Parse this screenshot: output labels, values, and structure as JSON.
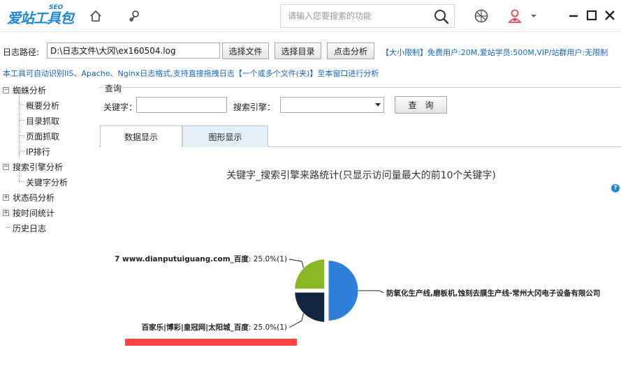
{
  "titlebar": {
    "logo_main": "爱站工具包",
    "logo_seo": "SEO",
    "search_placeholder": "请输入您要搜索的功能"
  },
  "toolbar": {
    "path_label": "日志路径:",
    "path_value": "D:\\日志文件\\大冈\\ex160504.log",
    "btn_select_file": "选择文件",
    "btn_select_dir": "选择目录",
    "btn_analyze": "点击分析",
    "limit_text": "【大小限制】免费用户:20M,爱站学员:500M,VIP/站群用户:无限制"
  },
  "info_line": "本工具可自动识别IIS、Apache、Nginx日志格式,支持直接拖拽日志【一个或多个文件(夹)】至本窗口进行分析",
  "sidebar": {
    "spider": "蜘蛛分析",
    "overview": "概要分析",
    "dir_crawl": "目录抓取",
    "page_crawl": "页面抓取",
    "ip_rank": "IP排行",
    "search_engine": "搜索引擎分析",
    "keyword": "关键字分析",
    "status_code": "状态码分析",
    "time_stats": "按时间统计",
    "history": "历史日志"
  },
  "query": {
    "title": "查询",
    "keyword_label": "关键字：",
    "engine_label": "搜索引擎：",
    "query_button": "查　询"
  },
  "tabs": {
    "data_tab": "数据显示",
    "graph_tab": "图形显示"
  },
  "colors": {
    "blue": "#2f80d9",
    "navy": "#0f2740",
    "green": "#8ab524",
    "red_bar": "#f44444"
  },
  "chart_data": {
    "type": "pie",
    "title": "关键字_搜索引擎来路统计(只显示访问量最大的前10个关键字)",
    "slices": [
      {
        "name": "防氧化生产线,磨板机,蚀刻去膜生产线-常州大冈电子设备有限公司",
        "value": 2,
        "percent": 50.0,
        "color": "#2f80d9",
        "label": "防氧化生产线,磨板机,蚀刻去膜生产线-常州大冈电子设备有限公司"
      },
      {
        "name": "百家乐|博彩|皇冠网|太阳城_百度",
        "value": 1,
        "percent": 25.0,
        "color": "#0f2740",
        "label_name": "百家乐|博彩|皇冠网|太阳城_百度",
        "label_val": ": 25.0%(1)"
      },
      {
        "name": "7 www.dianputuiguang.com_百度",
        "value": 1,
        "percent": 25.0,
        "color": "#8ab524",
        "label_name": "7 www.dianputuiguang.com_百度",
        "label_val": ": 25.0%(1)"
      }
    ]
  }
}
